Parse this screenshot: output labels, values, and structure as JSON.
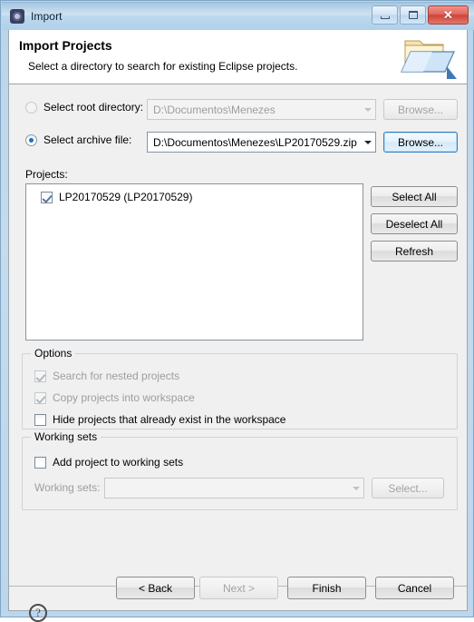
{
  "window": {
    "title": "Import",
    "icon": "eclipse-gear-icon",
    "minimize_label": "Minimize",
    "maximize_label": "Maximize",
    "close_label": "Close"
  },
  "banner": {
    "title": "Import Projects",
    "subtitle": "Select a directory to search for existing Eclipse projects.",
    "icon": "import-folder-icon"
  },
  "source": {
    "root_directory": {
      "radio_label": "Select root directory:",
      "selected": false,
      "enabled": false,
      "value": "D:\\Documentos\\Menezes",
      "browse_label": "Browse..."
    },
    "archive_file": {
      "radio_label": "Select archive file:",
      "selected": true,
      "enabled": true,
      "value": "D:\\Documentos\\Menezes\\LP20170529.zip",
      "browse_label": "Browse..."
    }
  },
  "projects": {
    "label": "Projects:",
    "items": [
      {
        "label": "LP20170529 (LP20170529)",
        "checked": true
      }
    ],
    "buttons": {
      "select_all": "Select All",
      "deselect_all": "Deselect All",
      "refresh": "Refresh"
    }
  },
  "options": {
    "title": "Options",
    "items": [
      {
        "label": "Search for nested projects",
        "checked": true,
        "enabled": false
      },
      {
        "label": "Copy projects into workspace",
        "checked": true,
        "enabled": false
      },
      {
        "label": "Hide projects that already exist in the workspace",
        "checked": false,
        "enabled": true
      }
    ]
  },
  "working_sets": {
    "title": "Working sets",
    "add_checkbox": {
      "label": "Add project to working sets",
      "checked": false,
      "enabled": true
    },
    "combo_label": "Working sets:",
    "combo_value": "",
    "select_label": "Select...",
    "enabled": false
  },
  "footer": {
    "help_glyph": "?",
    "back_label": "< Back",
    "next_label": "Next >",
    "finish_label": "Finish",
    "cancel_label": "Cancel",
    "next_enabled": false
  },
  "colors": {
    "accent": "#1d6fc0",
    "frame": "#b9d4ea",
    "dialog_bg": "#f0f0f0",
    "banner_bg": "#ffffff",
    "close_button": "#cf4437"
  }
}
